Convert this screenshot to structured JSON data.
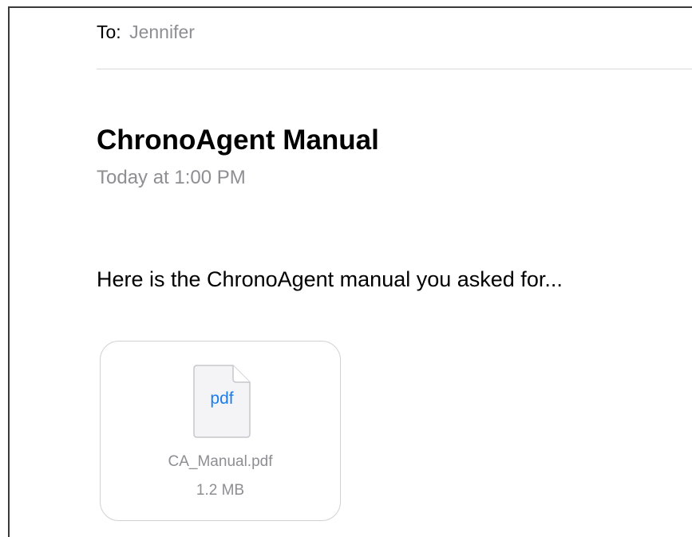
{
  "header": {
    "to_label": "To:",
    "to_value": "Jennifer"
  },
  "message": {
    "subject": "ChronoAgent Manual",
    "date": "Today at 1:00 PM",
    "body": "Here is the ChronoAgent manual you asked for..."
  },
  "attachment": {
    "icon": "pdf-file-icon",
    "type_label": "pdf",
    "file_name": "CA_Manual.pdf",
    "file_size": "1.2 MB"
  },
  "colors": {
    "secondary_text": "#8e8e93",
    "pdf_accent": "#1a7cf0",
    "border": "#d1d1d6"
  }
}
